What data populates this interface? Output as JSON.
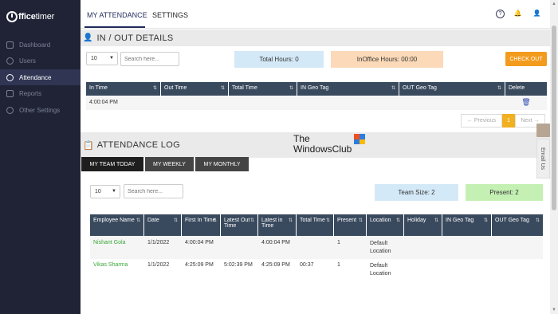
{
  "app": {
    "logo_letter": "O",
    "logo_bold": "ffice",
    "logo_thin": "timer"
  },
  "sidebar": {
    "items": [
      {
        "label": "Dashboard",
        "icon": "dashboard-icon",
        "active": false
      },
      {
        "label": "Users",
        "icon": "users-icon",
        "active": false
      },
      {
        "label": "Attendance",
        "icon": "attendance-icon",
        "active": true
      },
      {
        "label": "Reports",
        "icon": "reports-icon",
        "active": false
      },
      {
        "label": "Other Settings",
        "icon": "gear-icon",
        "active": false
      }
    ]
  },
  "topbar": {
    "tabs": [
      {
        "label": "MY ATTENDANCE",
        "active": true
      },
      {
        "label": "SETTINGS",
        "active": false
      }
    ],
    "help_glyph": "?",
    "bell_glyph": "🔔",
    "user_glyph": "👤"
  },
  "inout": {
    "title": "IN / OUT DETAILS",
    "entries": "10",
    "search_placeholder": "Search here...",
    "total_hours": "Total Hours: 0",
    "inoffice_hours": "InOffice Hours: 00:00",
    "checkout_label": "CHECK OUT",
    "columns": [
      "In Time",
      "Out Time",
      "Total Time",
      "IN Geo Tag",
      "OUT Geo Tag",
      "Delete"
    ],
    "rows": [
      {
        "in_time": "4:00:04 PM",
        "out_time": "",
        "total_time": "",
        "in_geo": "",
        "out_geo": ""
      }
    ],
    "pager": {
      "previous": "← Previous",
      "current": "1",
      "next": "Next →"
    }
  },
  "log": {
    "title": "ATTENDANCE LOG",
    "tabs": [
      "MY TEAM TODAY",
      "MY WEEKLY",
      "MY MONTHLY"
    ],
    "entries": "10",
    "search_placeholder": "Search here...",
    "team_size": "Team Size: 2",
    "present": "Present: 2",
    "columns": [
      "Employee Name",
      "Date",
      "First In Time",
      "Latest Out Time",
      "Latest in Time",
      "Total Time",
      "Present",
      "Location",
      "Holiday",
      "IN Geo Tag",
      "OUT Geo Tag"
    ],
    "rows": [
      {
        "name": "Nishant Gola",
        "date": "1/1/2022",
        "first_in": "4:00:04 PM",
        "latest_out": "",
        "latest_in": "4:00:04 PM",
        "total": "",
        "present": "1",
        "location": "Default Location",
        "holiday": "",
        "in_geo": "",
        "out_geo": ""
      },
      {
        "name": "Vikas Sharma",
        "date": "1/1/2022",
        "first_in": "4:25:09 PM",
        "latest_out": "5:02:39 PM",
        "latest_in": "4:25:09 PM",
        "total": "00:37",
        "present": "1",
        "location": "Default Location",
        "holiday": "",
        "in_geo": "",
        "out_geo": ""
      }
    ]
  },
  "watermark": {
    "line1": "The",
    "line2": "WindowsClub"
  },
  "email_us": "Email Us",
  "colors": {
    "sidebar_bg": "#1f2335",
    "header_row": "#3a4a5e",
    "checkout": "#f29b1d",
    "total_hours_bg": "#d4e9f7",
    "inoffice_bg": "#fcd9b8",
    "team_size_bg": "#d4e9f7",
    "present_bg": "#c4f0b4",
    "name_link": "#3aa83a"
  }
}
